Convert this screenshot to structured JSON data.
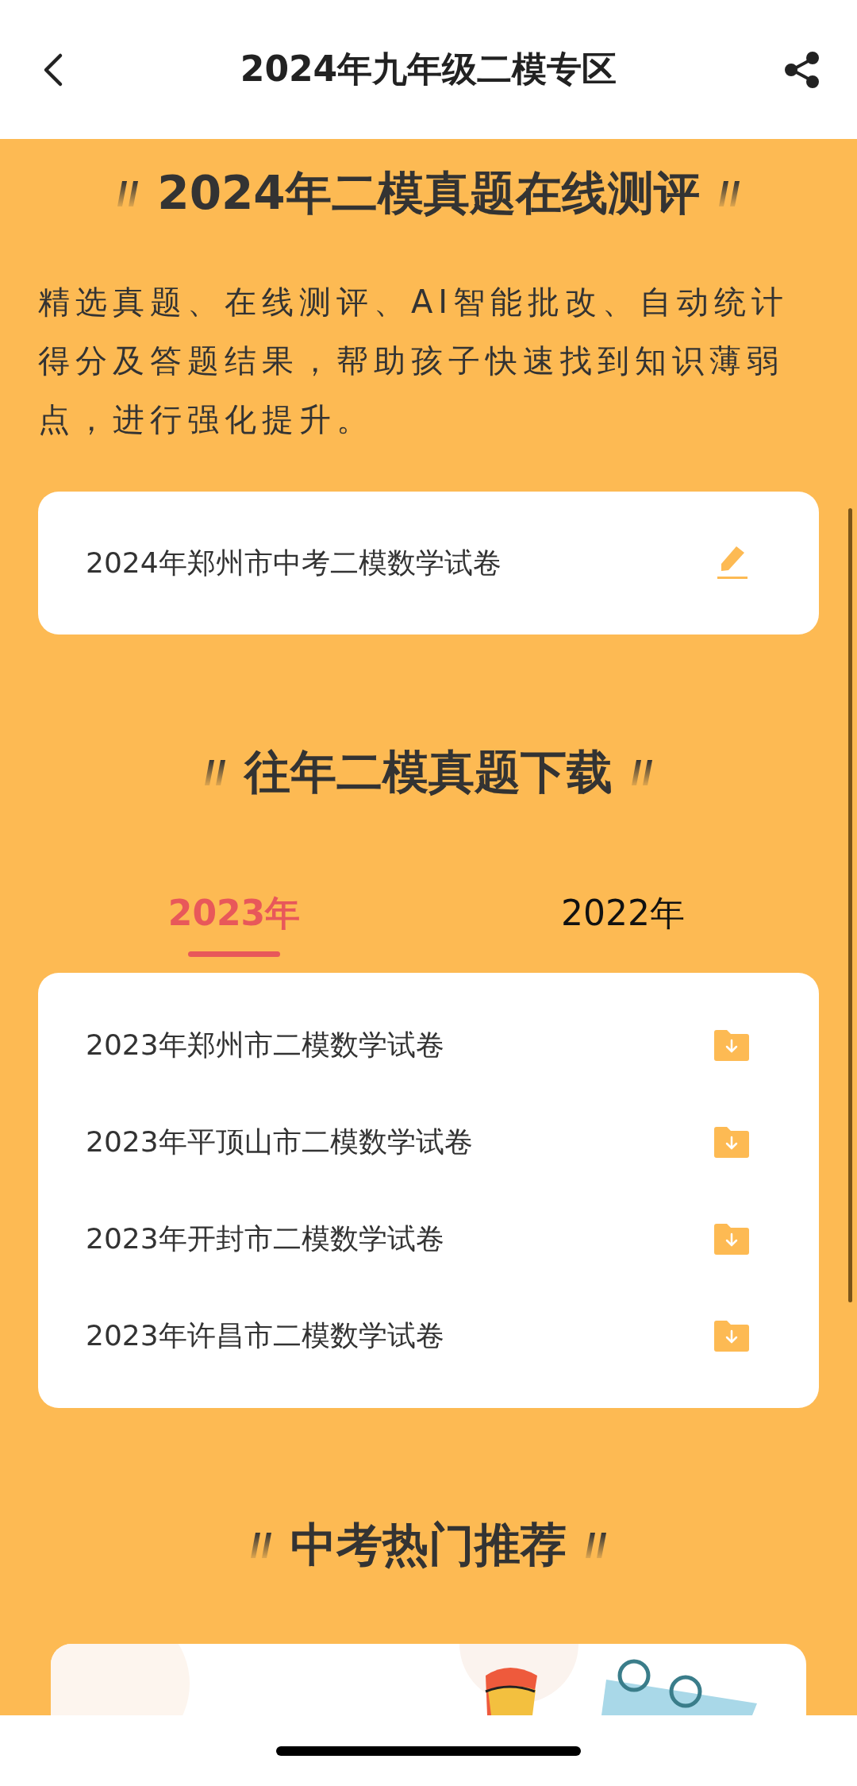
{
  "header": {
    "title": "2024年九年级二模专区"
  },
  "online_test": {
    "heading": "2024年二模真题在线测评",
    "description": "精选真题、在线测评、AI智能批改、自动统计得分及答题结果，帮助孩子快速找到知识薄弱点，进行强化提升。",
    "papers": [
      {
        "title": "2024年郑州市中考二模数学试卷"
      }
    ]
  },
  "downloads": {
    "heading": "往年二模真题下载",
    "tabs": [
      {
        "label": "2023年",
        "selected": true
      },
      {
        "label": "2022年",
        "selected": false
      }
    ],
    "papers": [
      {
        "title": "2023年郑州市二模数学试卷"
      },
      {
        "title": "2023年平顶山市二模数学试卷"
      },
      {
        "title": "2023年开封市二模数学试卷"
      },
      {
        "title": "2023年许昌市二模数学试卷"
      }
    ]
  },
  "recommend": {
    "heading": "中考热门推荐"
  }
}
